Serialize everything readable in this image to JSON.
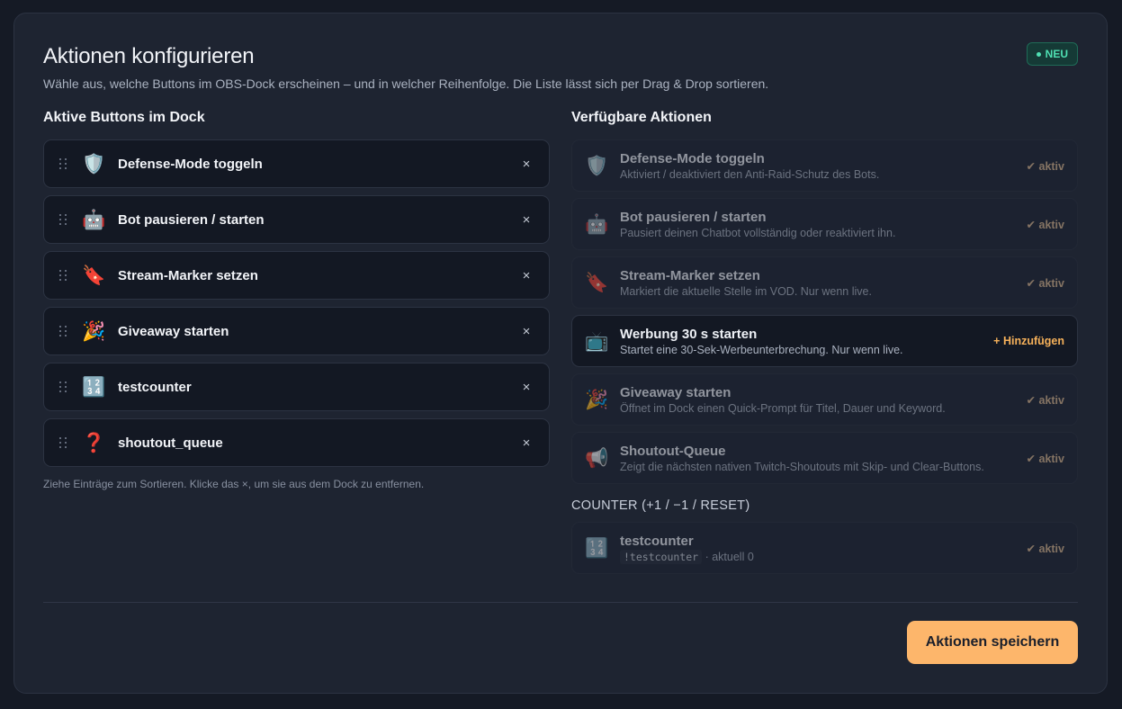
{
  "header": {
    "title": "Aktionen konfigurieren",
    "subtitle": "Wähle aus, welche Buttons im OBS-Dock erscheinen – und in welcher Reihenfolge. Die Liste lässt sich per Drag & Drop sortieren.",
    "badge": "NEU"
  },
  "left": {
    "heading": "Aktive Buttons im Dock",
    "items": [
      {
        "emoji": "🛡️",
        "label": "Defense-Mode toggeln"
      },
      {
        "emoji": "🤖",
        "label": "Bot pausieren / starten"
      },
      {
        "emoji": "🔖",
        "label": "Stream-Marker setzen"
      },
      {
        "emoji": "🎉",
        "label": "Giveaway starten"
      },
      {
        "emoji": "🔢",
        "label": "testcounter"
      },
      {
        "emoji": "❓",
        "label": "shoutout_queue"
      }
    ],
    "remove_glyph": "×",
    "hint": "Ziehe Einträge zum Sortieren. Klicke das ×, um sie aus dem Dock zu entfernen."
  },
  "right": {
    "heading": "Verfügbare Aktionen",
    "items": [
      {
        "emoji": "🛡️",
        "title": "Defense-Mode toggeln",
        "desc": "Aktiviert / deaktiviert den Anti-Raid-Schutz des Bots.",
        "status": "✔ aktiv"
      },
      {
        "emoji": "🤖",
        "title": "Bot pausieren / starten",
        "desc": "Pausiert deinen Chatbot vollständig oder reaktiviert ihn.",
        "status": "✔ aktiv"
      },
      {
        "emoji": "🔖",
        "title": "Stream-Marker setzen",
        "desc": "Markiert die aktuelle Stelle im VOD. Nur wenn live.",
        "status": "✔ aktiv"
      },
      {
        "emoji": "📺",
        "title": "Werbung 30 s starten",
        "desc": "Startet eine 30-Sek-Werbeunterbrechung. Nur wenn live.",
        "action": "+ Hinzufügen"
      },
      {
        "emoji": "🎉",
        "title": "Giveaway starten",
        "desc": "Öffnet im Dock einen Quick-Prompt für Titel, Dauer und Keyword.",
        "status": "✔ aktiv"
      },
      {
        "emoji": "📢",
        "title": "Shoutout-Queue",
        "desc": "Zeigt die nächsten nativen Twitch-Shoutouts mit Skip- und Clear-Buttons.",
        "status": "✔ aktiv"
      }
    ],
    "counter_section": "COUNTER (+1 / −1 / RESET)",
    "counter": {
      "emoji": "🔢",
      "title": "testcounter",
      "command": "!testcounter",
      "value_text": "· aktuell 0",
      "status": "✔ aktiv"
    }
  },
  "footer": {
    "save_label": "Aktionen speichern"
  },
  "colors": {
    "accent": "#fdb66b",
    "badge": "#4fe0b3",
    "panel": "#1e2431",
    "background": "#151a25"
  }
}
